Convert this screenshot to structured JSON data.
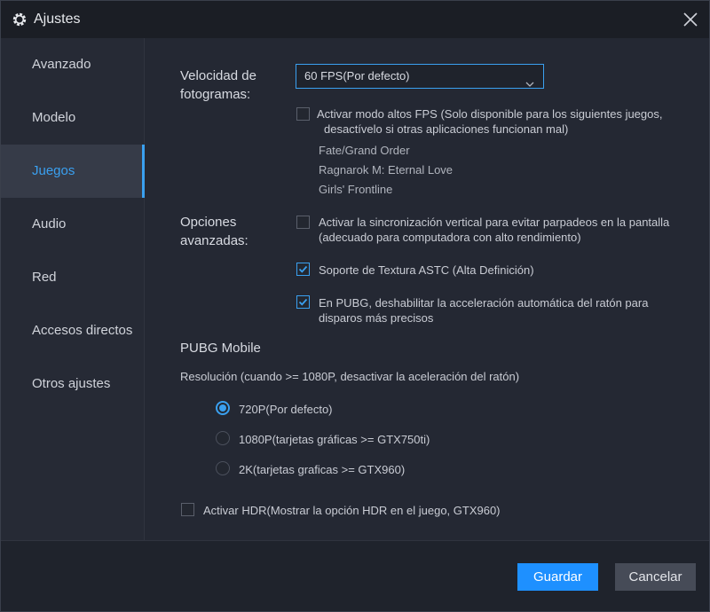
{
  "window": {
    "title": "Ajustes"
  },
  "sidebar": {
    "items": [
      {
        "label": "Avanzado"
      },
      {
        "label": "Modelo"
      },
      {
        "label": "Juegos"
      },
      {
        "label": "Audio"
      },
      {
        "label": "Red"
      },
      {
        "label": "Accesos directos"
      },
      {
        "label": "Otros ajustes"
      }
    ],
    "active": "Juegos"
  },
  "framerate": {
    "label_line1": "Velocidad de",
    "label_line2": "fotogramas:",
    "selected": "60  FPS(Por defecto)",
    "high_fps": {
      "checked": false,
      "text_line1": "Activar modo altos FPS   (Solo disponible para los siguientes juegos,",
      "text_line2": "desactívelo si otras aplicaciones funcionan mal)"
    },
    "games": [
      "Fate/Grand Order",
      "Ragnarok M: Eternal Love",
      "Girls' Frontline"
    ]
  },
  "advanced": {
    "label_line1": "Opciones",
    "label_line2": "avanzadas:",
    "vsync": {
      "checked": false,
      "text_line1": "Activar la sincronización vertical para evitar parpadeos en la pantalla",
      "text_line2": "(adecuado para computadora con alto rendimiento)"
    },
    "astc": {
      "checked": true,
      "text": "Soporte de Textura ASTC   (Alta Definición)"
    },
    "pubg_mouse": {
      "checked": true,
      "text_line1": "En PUBG, deshabilitar la acceleración automática del ratón para",
      "text_line2": "disparos más precisos"
    }
  },
  "pubg": {
    "heading": "PUBG Mobile",
    "resolution_label": "Resolución (cuando >= 1080P, desactivar la aceleración del ratón)",
    "options": [
      {
        "label": "720P(Por defecto)",
        "selected": true
      },
      {
        "label": "1080P(tarjetas gráficas >= GTX750ti)",
        "selected": false
      },
      {
        "label": "2K(tarjetas graficas >= GTX960)",
        "selected": false
      }
    ],
    "hdr": {
      "checked": false,
      "text": "Activar HDR(Mostrar la opción HDR en el juego, GTX960)"
    }
  },
  "footer": {
    "save_label": "Guardar",
    "cancel_label": "Cancelar"
  },
  "colors": {
    "accent": "#3aa0f0",
    "primary_button": "#1e90ff",
    "background": "#242833"
  },
  "icons": {
    "title": "gear-icon",
    "close": "close-icon",
    "dropdown": "chevron-down-icon"
  }
}
